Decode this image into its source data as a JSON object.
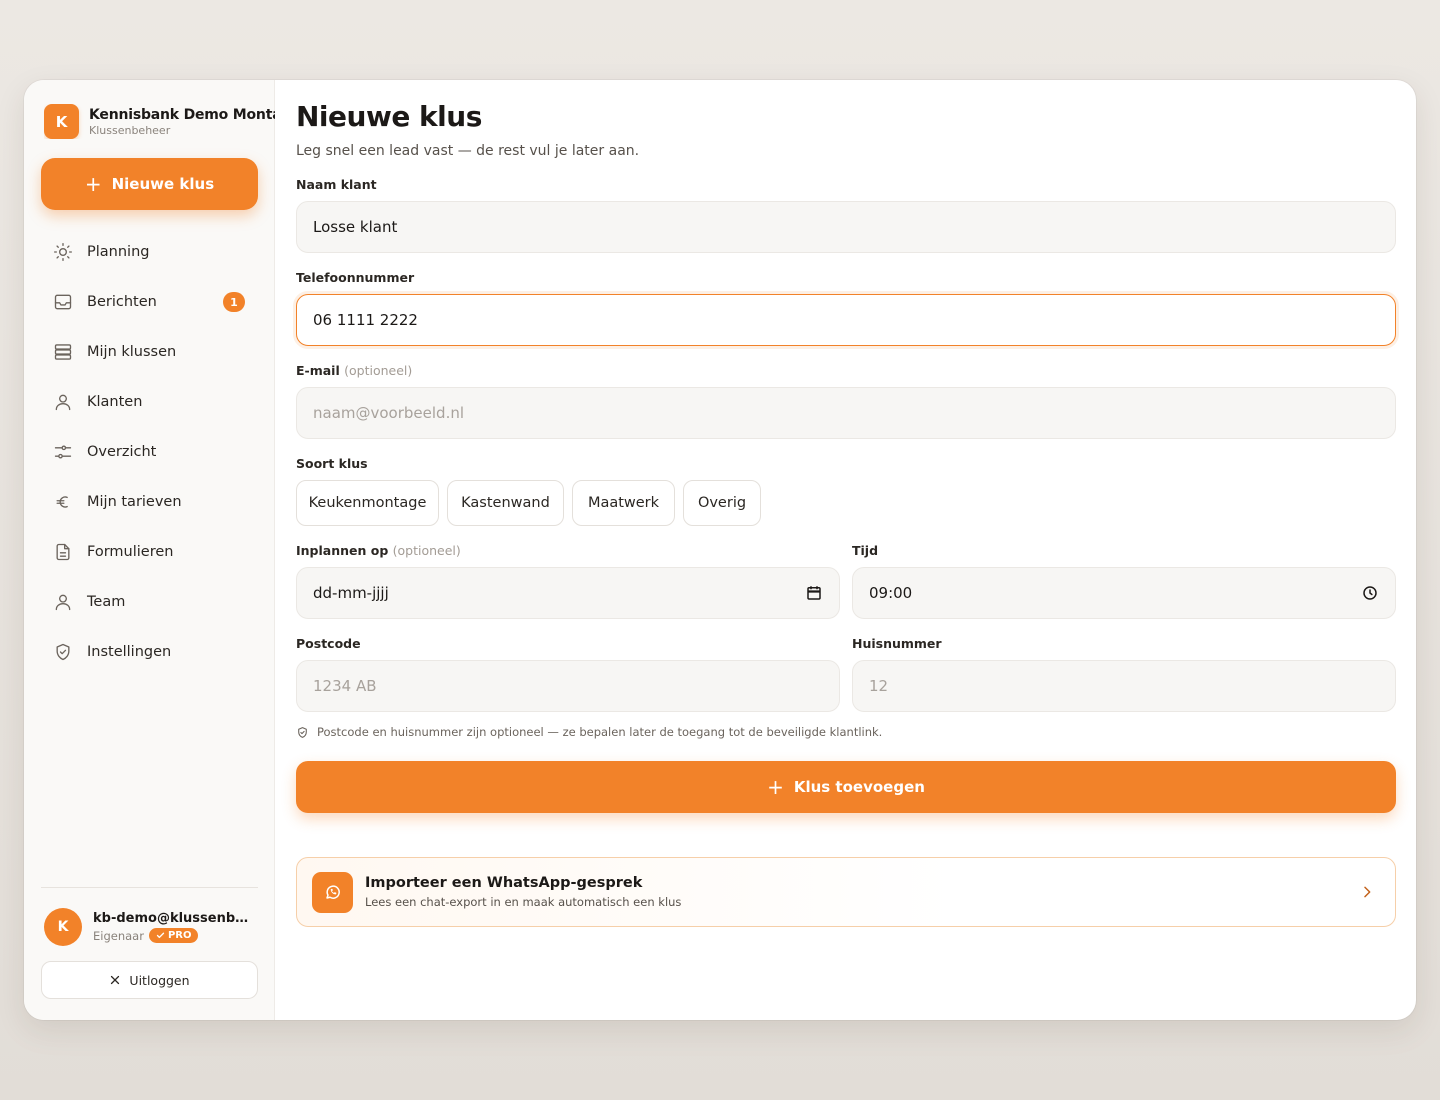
{
  "brand": {
    "logo_letter": "K",
    "name": "Kennisbank Demo Montage",
    "subtitle": "Klussenbeheer"
  },
  "sidebar": {
    "new_button": "Nieuwe klus",
    "items": [
      {
        "label": "Planning",
        "icon": "sun-icon"
      },
      {
        "label": "Berichten",
        "icon": "inbox-icon",
        "badge": "1"
      },
      {
        "label": "Mijn klussen",
        "icon": "stack-icon"
      },
      {
        "label": "Klanten",
        "icon": "user-icon"
      },
      {
        "label": "Overzicht",
        "icon": "sliders-icon"
      },
      {
        "label": "Mijn tarieven",
        "icon": "euro-icon"
      },
      {
        "label": "Formulieren",
        "icon": "document-icon"
      },
      {
        "label": "Team",
        "icon": "user-icon"
      },
      {
        "label": "Instellingen",
        "icon": "shield-icon"
      }
    ],
    "user": {
      "avatar_letter": "K",
      "email": "kb-demo@klussenbeheer.nl",
      "role": "Eigenaar",
      "badge": "PRO"
    },
    "logout": "Uitloggen"
  },
  "main": {
    "title": "Nieuwe klus",
    "subtitle": "Leg snel een lead vast — de rest vul je later aan.",
    "name_label": "Naam klant",
    "name_value": "Losse klant",
    "phone_label": "Telefoonnummer",
    "phone_value": "06 1111 2222",
    "email_label": "E-mail",
    "email_optional": "(optioneel)",
    "email_placeholder": "naam@voorbeeld.nl",
    "type_label": "Soort klus",
    "types": [
      "Keukenmontage",
      "Kastenwand",
      "Maatwerk",
      "Overig"
    ],
    "schedule_label": "Inplannen op",
    "schedule_optional": "(optioneel)",
    "date_value": "dd-mm-jjjj",
    "time_label": "Tijd",
    "time_value": "09:00",
    "postcode_label": "Postcode",
    "postcode_placeholder": "1234 AB",
    "housenumber_label": "Huisnummer",
    "housenumber_placeholder": "12",
    "hint": "Postcode en huisnummer zijn optioneel — ze bepalen later de toegang tot de beveiligde klantlink.",
    "submit": "Klus toevoegen",
    "whatsapp": {
      "title": "Importeer een WhatsApp-gesprek",
      "subtitle": "Lees een chat-export in en maak automatisch een klus"
    }
  },
  "colors": {
    "accent": "#f28229",
    "background": "#e9e5e0"
  }
}
